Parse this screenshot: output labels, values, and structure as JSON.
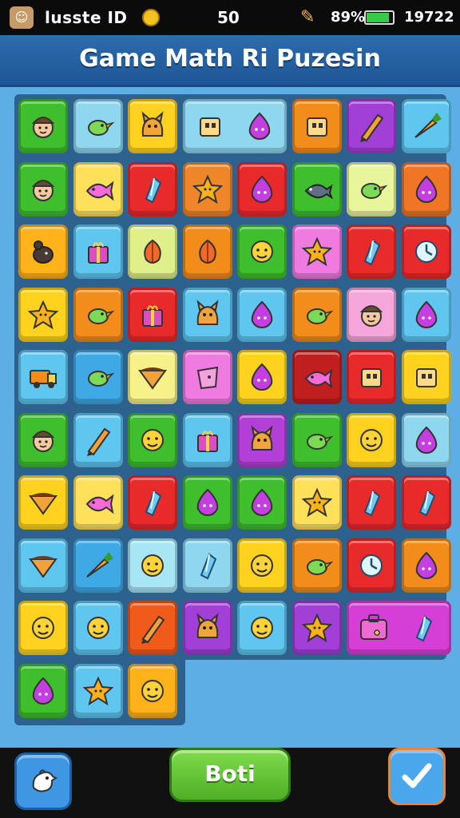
{
  "status": {
    "name": "lusste ID",
    "score": "50",
    "battery_text": "89%",
    "battery_level": 0.89,
    "time": "19722"
  },
  "title": "Game Math Ri Puzesin",
  "footer": {
    "left_icon": "chicken-head-icon",
    "center_label": "Boti",
    "right_icon": "checkmark-icon"
  },
  "board": {
    "rows": [
      [
        {
          "color": "#3fbf2e",
          "icon": "face"
        },
        {
          "color": "#8fd6ef",
          "icon": "bird"
        },
        {
          "color": "#ffd21f",
          "icon": "creature"
        },
        {
          "color": "#8fd6ef",
          "icon": "box",
          "wide": true
        },
        {
          "color": "#8fd6ef",
          "icon": "blob",
          "skip": true
        },
        {
          "color": "#f28c1a",
          "icon": "box"
        },
        {
          "color": "#a23fd6",
          "icon": "pencil"
        },
        {
          "color": "#5fc6f0",
          "icon": "carrot"
        }
      ],
      [
        {
          "color": "#3fbf2e",
          "icon": "face"
        },
        {
          "color": "#ffe05a",
          "icon": "fish"
        },
        {
          "color": "#e92a2a",
          "icon": "crystal"
        },
        {
          "color": "#f0862a",
          "icon": "star"
        },
        {
          "color": "#e92a2a",
          "icon": "blob"
        },
        {
          "color": "#3fbf2e",
          "icon": "sunfish"
        },
        {
          "color": "#e9f59a",
          "icon": "bird"
        },
        {
          "color": "#f07525",
          "icon": "blob"
        }
      ],
      [
        {
          "color": "#ffb21a",
          "icon": "mouse"
        },
        {
          "color": "#5fc6f0",
          "icon": "gift"
        },
        {
          "color": "#dff08a",
          "icon": "leaf"
        },
        {
          "color": "#f28c1a",
          "icon": "leaf"
        },
        {
          "color": "#3fbf2e",
          "icon": "smile"
        },
        {
          "color": "#f07be0",
          "icon": "star"
        },
        {
          "color": "#e92a2a",
          "icon": "crystal"
        },
        {
          "color": "#e92a2a",
          "icon": "clock"
        }
      ],
      [
        {
          "color": "#ffd21f",
          "icon": "star"
        },
        {
          "color": "#f28c1a",
          "icon": "bird"
        },
        {
          "color": "#e92a2a",
          "icon": "gift"
        },
        {
          "color": "#5fc6f0",
          "icon": "creature"
        },
        {
          "color": "#5fc6f0",
          "icon": "blob"
        },
        {
          "color": "#f28c1a",
          "icon": "bird"
        },
        {
          "color": "#f5a7dc",
          "icon": "face"
        },
        {
          "color": "#5fc6f0",
          "icon": "blob"
        }
      ],
      [
        {
          "color": "#5fc6f0",
          "icon": "truck"
        },
        {
          "color": "#3fa9e6",
          "icon": "bird"
        },
        {
          "color": "#f7f18a",
          "icon": "slice"
        },
        {
          "color": "#f07be0",
          "icon": "pot"
        },
        {
          "color": "#ffd21f",
          "icon": "blob"
        },
        {
          "color": "#c01f1f",
          "icon": "fish"
        },
        {
          "color": "#e92a2a",
          "icon": "box"
        },
        {
          "color": "#ffd21f",
          "icon": "box"
        }
      ],
      [
        {
          "color": "#3fbf2e",
          "icon": "face"
        },
        {
          "color": "#5fc6f0",
          "icon": "pencil"
        },
        {
          "color": "#3fbf2e",
          "icon": "smile"
        },
        {
          "color": "#5fc6f0",
          "icon": "gift"
        },
        {
          "color": "#b23fd6",
          "icon": "creature"
        },
        {
          "color": "#3fbf2e",
          "icon": "bird"
        },
        {
          "color": "#ffd21f",
          "icon": "smile"
        },
        {
          "color": "#8fd6ef",
          "icon": "blob"
        }
      ],
      [
        {
          "color": "#ffd21f",
          "icon": "slice"
        },
        {
          "color": "#ffe05a",
          "icon": "fish"
        },
        {
          "color": "#e92a2a",
          "icon": "crystal"
        },
        {
          "color": "#3fbf2e",
          "icon": "blob"
        },
        {
          "color": "#3fbf2e",
          "icon": "blob"
        },
        {
          "color": "#ffe05a",
          "icon": "star"
        },
        {
          "color": "#e92a2a",
          "icon": "crystal"
        },
        {
          "color": "#e92a2a",
          "icon": "crystal"
        }
      ],
      [
        {
          "color": "#5fc6f0",
          "icon": "slice"
        },
        {
          "color": "#3fa9e6",
          "icon": "carrot"
        },
        {
          "color": "#a8e6f5",
          "icon": "smile"
        },
        {
          "color": "#8fd6ef",
          "icon": "crystal"
        },
        {
          "color": "#ffd21f",
          "icon": "smile"
        },
        {
          "color": "#f28c1a",
          "icon": "bird"
        },
        {
          "color": "#e92a2a",
          "icon": "clock"
        },
        {
          "color": "#f28c1a",
          "icon": "blob"
        }
      ],
      [
        {
          "color": "#ffd21f",
          "icon": "smile"
        },
        {
          "color": "#5fc6f0",
          "icon": "smile"
        },
        {
          "color": "#f05a1a",
          "icon": "pencil"
        },
        {
          "color": "#a23fd6",
          "icon": "creature"
        },
        {
          "color": "#5fc6f0",
          "icon": "smile"
        },
        {
          "color": "#a23fd6",
          "icon": "star"
        },
        {
          "color": "#d63fd6",
          "icon": "bag",
          "wide": true
        },
        {
          "color": "#d63fd6",
          "icon": "crystal",
          "skip": true
        }
      ],
      [
        {
          "color": "#3fbf2e",
          "icon": "blob"
        },
        {
          "color": "#5fc6f0",
          "icon": "star"
        },
        {
          "color": "#ffb21a",
          "icon": "smile"
        }
      ]
    ]
  }
}
